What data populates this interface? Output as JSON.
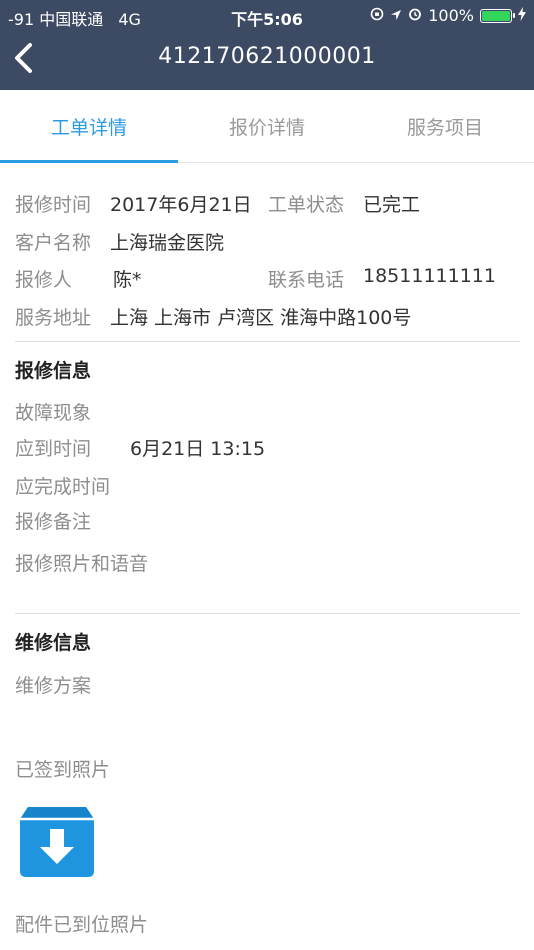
{
  "status_bar": {
    "carrier": "-91 中国联通",
    "network": "4G",
    "time": "下午5:06",
    "battery": "100%",
    "battery_level": 1.0,
    "battery_color": "#35d45a"
  },
  "nav": {
    "back_icon": "chevron-left-icon",
    "title": "412170621000001",
    "bg_color": "#3d4a63"
  },
  "tabs": [
    {
      "label": "工单详情",
      "active": true
    },
    {
      "label": "报价详情",
      "active": false
    },
    {
      "label": "服务项目",
      "active": false
    }
  ],
  "accent_color": "#2d9be3",
  "order": {
    "repair_time_label": "报修时间",
    "repair_time": "2017年6月21日",
    "status_label": "工单状态",
    "status": "已完工",
    "customer_label": "客户名称",
    "customer": "上海瑞金医院",
    "reporter_label": "报修人",
    "reporter": "陈*",
    "phone_label": "联系电话",
    "phone": "18511111111",
    "address_label": "服务地址",
    "address": "上海 上海市 卢湾区 淮海中路100号"
  },
  "repair_info": {
    "title": "报修信息",
    "fault_label": "故障现象",
    "due_time_label": "应到时间",
    "due_time": "6月21日 13:15",
    "due_complete_label": "应完成时间",
    "remarks_label": "报修备注",
    "photos_label": "报修照片和语音"
  },
  "maintenance_info": {
    "title": "维修信息",
    "plan_label": "维修方案",
    "checkin_photos_label": "已签到照片",
    "checkin_photo_icon": "download-box-icon",
    "parts_photos_label": "配件已到位照片"
  }
}
